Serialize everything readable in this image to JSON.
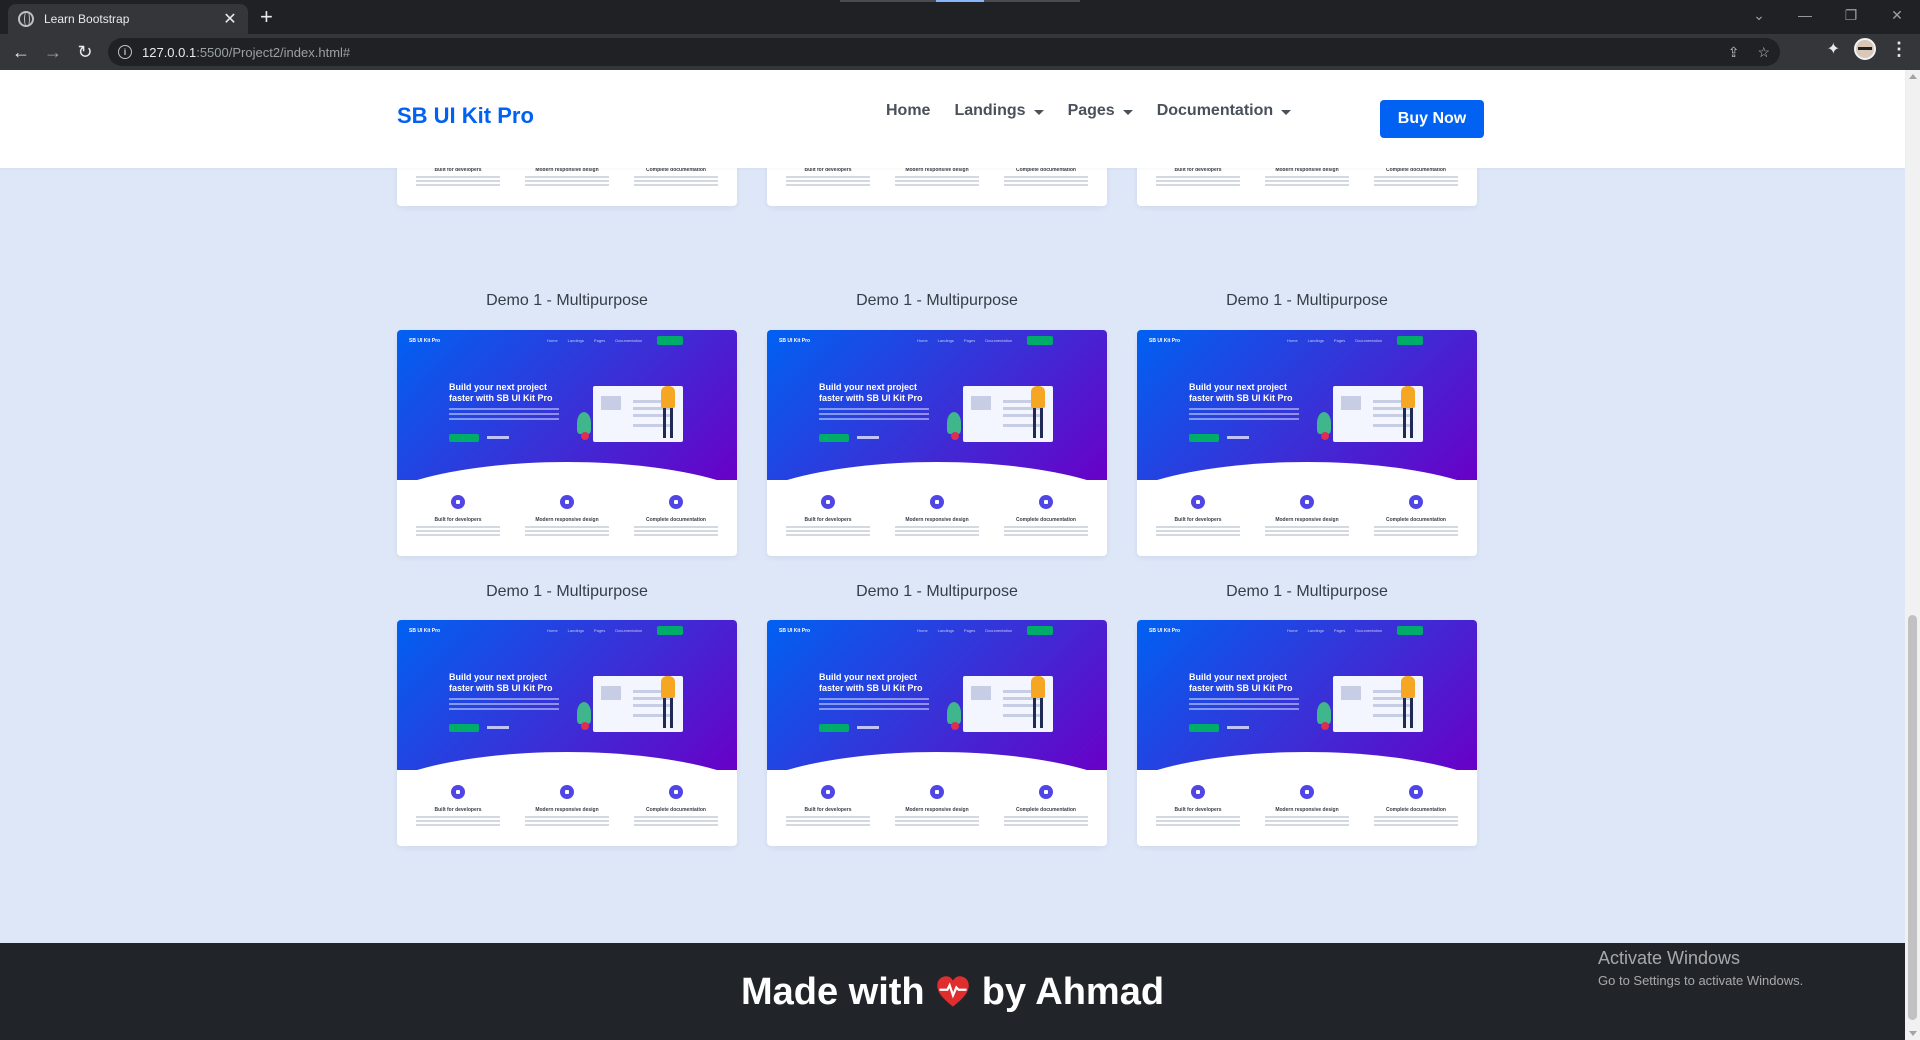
{
  "browser": {
    "tab_title": "Learn Bootstrap",
    "tab_close": "✕",
    "new_tab": "+",
    "url_host": "127.0.0.1",
    "url_path": ":5500/Project2/index.html#",
    "win_min": "—",
    "win_restore": "❐",
    "win_close": "✕"
  },
  "navbar": {
    "brand": "SB UI Kit Pro",
    "links": [
      {
        "label": "Home",
        "dropdown": false
      },
      {
        "label": "Landings",
        "dropdown": true
      },
      {
        "label": "Pages",
        "dropdown": true
      },
      {
        "label": "Documentation",
        "dropdown": true
      }
    ],
    "cta": "Buy Now"
  },
  "demos": [
    {
      "title": "Demo 1 - Multipurpose"
    },
    {
      "title": "Demo 1 - Multipurpose"
    },
    {
      "title": "Demo 1 - Multipurpose"
    },
    {
      "title": "Demo 1 - Multipurpose"
    },
    {
      "title": "Demo 1 - Multipurpose"
    },
    {
      "title": "Demo 1 - Multipurpose"
    }
  ],
  "thumbnail": {
    "brand": "SB UI Kit Pro",
    "nav": [
      "Home",
      "Landings",
      "Pages",
      "Documentation"
    ],
    "headline": "Build your next project faster with SB UI Kit Pro",
    "features": [
      "Built for developers",
      "Modern responsive design",
      "Complete documentation"
    ]
  },
  "footer": {
    "made_with": "Made with",
    "by": "by Ahmad"
  },
  "os_watermark": {
    "title": "Activate Windows",
    "subtitle": "Go to Settings to activate Windows."
  },
  "colors": {
    "primary": "#0061f2",
    "page_bg": "#dde7f8",
    "footer_bg": "#212529",
    "heart": "#e02d2d"
  }
}
